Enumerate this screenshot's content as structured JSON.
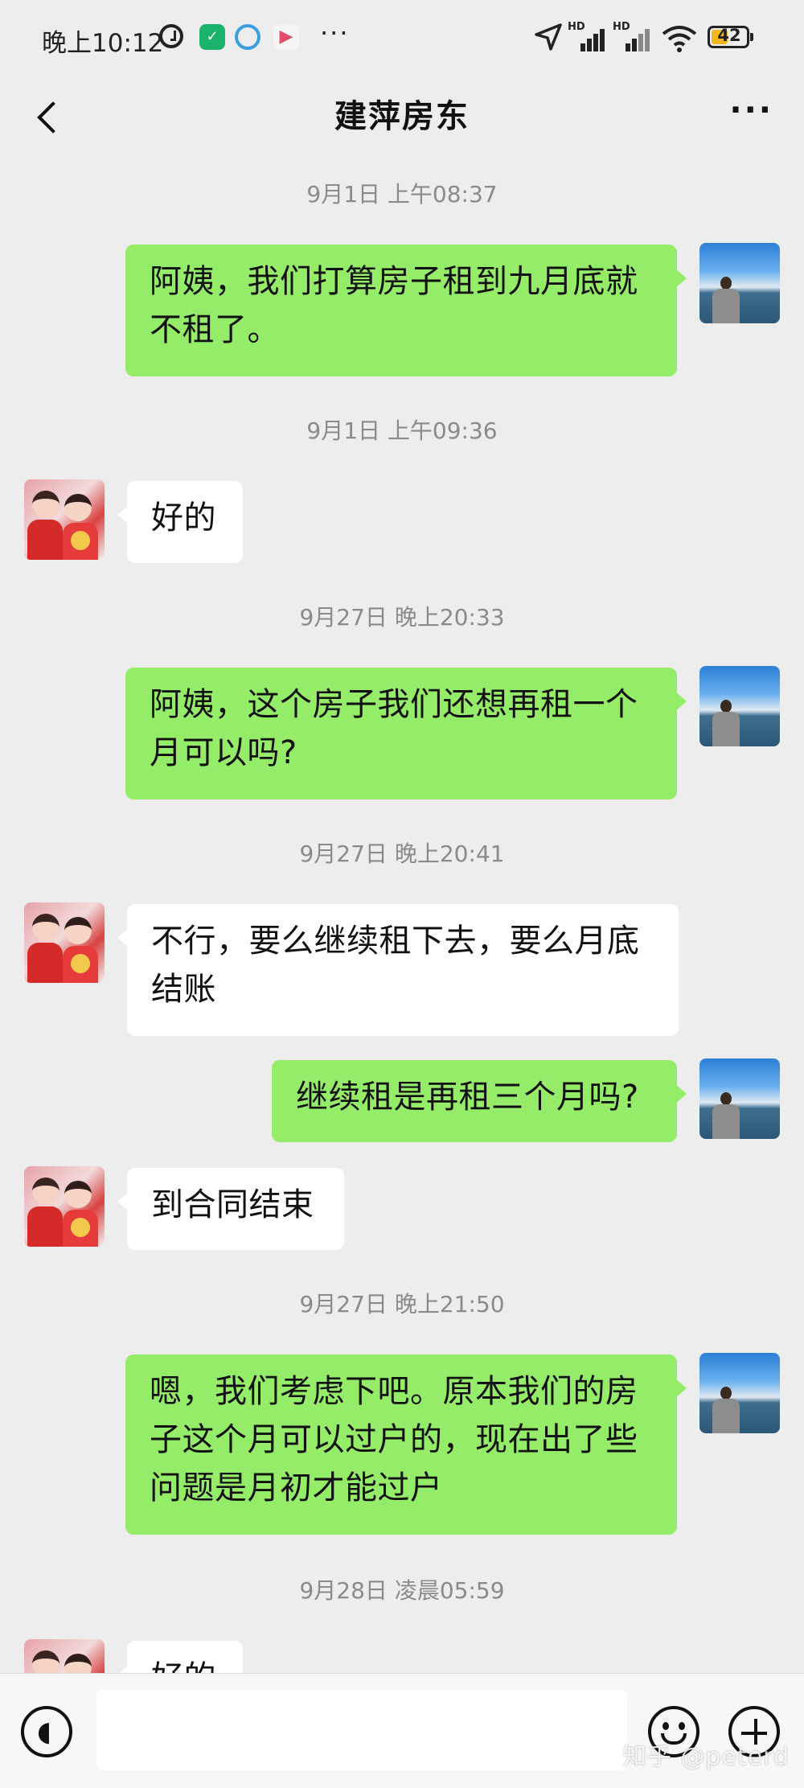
{
  "status_bar": {
    "time": "晚上10:12",
    "more": "···",
    "network_tag_1": "HD",
    "network_tag_2": "HD",
    "battery": "42",
    "icons": [
      "alarm-icon",
      "security-app-icon",
      "search-app-icon",
      "video-app-icon",
      "location-icon",
      "signal-icon",
      "signal-icon",
      "wifi-icon",
      "battery-icon"
    ]
  },
  "header": {
    "title": "建萍房东",
    "back_icon": "chevron-left-icon",
    "more_label": "···"
  },
  "messages": [
    {
      "type": "time",
      "text": "9月1日 上午08:37"
    },
    {
      "type": "me",
      "text": "阿姨，我们打算房子租到九月底就不租了。"
    },
    {
      "type": "time",
      "text": "9月1日 上午09:36"
    },
    {
      "type": "her",
      "text": "好的"
    },
    {
      "type": "time",
      "text": "9月27日 晚上20:33"
    },
    {
      "type": "me",
      "text": "阿姨，这个房子我们还想再租一个月可以吗?"
    },
    {
      "type": "time",
      "text": "9月27日 晚上20:41"
    },
    {
      "type": "her",
      "text": "不行，要么继续租下去，要么月底结账"
    },
    {
      "type": "me",
      "text": "继续租是再租三个月吗?"
    },
    {
      "type": "her",
      "text": "到合同结束"
    },
    {
      "type": "time",
      "text": "9月27日 晚上21:50"
    },
    {
      "type": "me",
      "text": "嗯，我们考虑下吧。原本我们的房子这个月可以过户的，现在出了些问题是月初才能过户"
    },
    {
      "type": "time",
      "text": "9月28日 凌晨05:59"
    },
    {
      "type": "her",
      "text": "好的"
    }
  ],
  "input_bar": {
    "voice_icon": "voice-icon",
    "text_value": "",
    "emoji_icon": "emoji-icon",
    "plus_icon": "plus-icon"
  },
  "watermark": "知乎 @peterd"
}
